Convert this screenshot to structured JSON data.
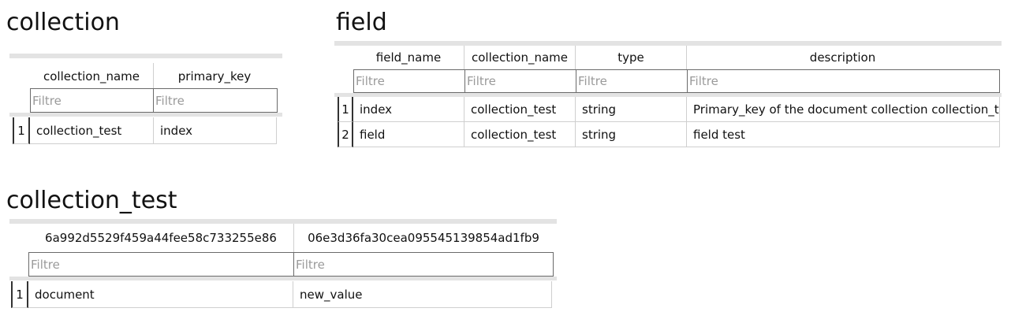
{
  "tables": {
    "collection": {
      "title": "collection",
      "filter_placeholder": "Filtre",
      "columns": [
        "collection_name",
        "primary_key"
      ],
      "rows": [
        {
          "num": "1",
          "cells": [
            "collection_test",
            "index"
          ]
        }
      ]
    },
    "field": {
      "title": "field",
      "filter_placeholder": "Filtre",
      "columns": [
        "field_name",
        "collection_name",
        "type",
        "description"
      ],
      "rows": [
        {
          "num": "1",
          "cells": [
            "index",
            "collection_test",
            "string",
            "Primary_key of the document collection collection_test"
          ]
        },
        {
          "num": "2",
          "cells": [
            "field",
            "collection_test",
            "string",
            "field test"
          ]
        }
      ]
    },
    "collection_test": {
      "title": "collection_test",
      "filter_placeholder": "Filtre",
      "columns": [
        "6a992d5529f459a44fee58c733255e86",
        "06e3d36fa30cea095545139854ad1fb9"
      ],
      "rows": [
        {
          "num": "1",
          "cells": [
            "document",
            "new_value"
          ]
        }
      ]
    }
  }
}
